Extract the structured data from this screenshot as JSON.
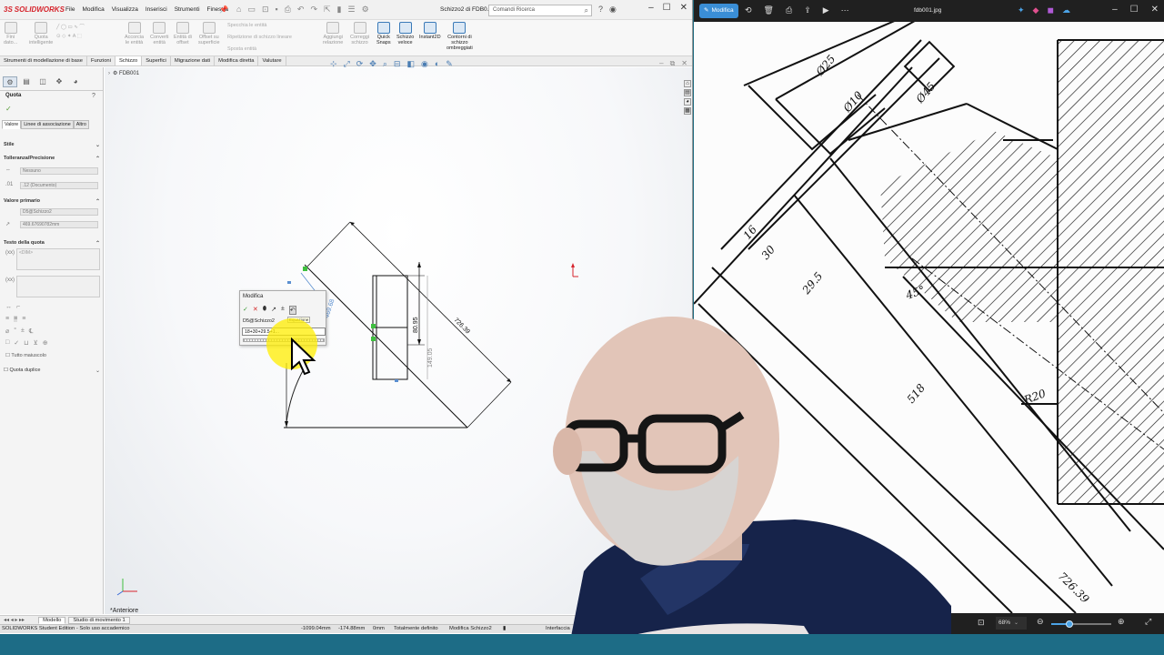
{
  "solidworks": {
    "logo_text": "SOLIDWORKS",
    "menu": [
      "File",
      "Modifica",
      "Visualizza",
      "Inserisci",
      "Strumenti",
      "Finestra"
    ],
    "doc_title": "Schizzo2 di FDB0...",
    "search_placeholder": "Comandi Ricerca",
    "ribbon": {
      "buttons": [
        {
          "label": "Fini\ndato...",
          "enabled": false
        },
        {
          "label": "Quota\nintelligente",
          "enabled": false
        },
        {
          "label": "Accorcia\nle entità",
          "enabled": false
        },
        {
          "label": "Converti\nentità",
          "enabled": false
        },
        {
          "label": "Entità di\noffset",
          "enabled": false
        },
        {
          "label": "Offset su\nsuperficie",
          "enabled": false
        },
        {
          "label": "Aggiungi\nrelazione",
          "enabled": false
        },
        {
          "label": "Correggi\nschizzo",
          "enabled": false
        },
        {
          "label": "Quick\nSnaps",
          "enabled": true
        },
        {
          "label": "Schizzo\nveloce",
          "enabled": true
        },
        {
          "label": "Instant2D",
          "enabled": true
        },
        {
          "label": "Contorni di\nschizzo\nombreggiati",
          "enabled": true
        }
      ],
      "small_items": [
        "Specchia le entità",
        "Ripetizione di schizzo lineare",
        "Sposta entità"
      ]
    },
    "command_tabs": [
      "Strumenti di modellazione di base",
      "Funzioni",
      "Schizzo",
      "Superfici",
      "Migrazione dati",
      "Modifica diretta",
      "Valutare"
    ],
    "active_command_tab": "Schizzo",
    "property_manager": {
      "title": "Quota",
      "subtabs": [
        "Valore",
        "Linee di associazione",
        "Altro"
      ],
      "sections": {
        "stile": "Stile",
        "tolleranza": "Tolleranza/Precisione",
        "tolleranza_value": "Nessuno",
        "precisione_value": ".12 (Documento)",
        "valore_primario": "Valore primario",
        "dim_name": "D5@Schizzo2",
        "dim_value": "469.67690782mm",
        "testo_quota": "Testo della quota",
        "dim_token": "<DIM>",
        "tutto_maiuscolo": "Tutto maiuscolo",
        "quota_duplice": "Quota duplice"
      }
    },
    "tree_root": "FDB001",
    "view_label": "*Anteriore",
    "dimensions": {
      "diag": "726.39",
      "vert": "80.95",
      "vert2": "149.05",
      "small": "469.68"
    },
    "modify_dialog": {
      "title": "Modifica",
      "dim_name": "D5@Schizzo2",
      "tooltip": "Equazione",
      "expression": "18+30+29.5+1..."
    },
    "bottom_tabs": [
      "Modello",
      "Studio di movimento 1"
    ],
    "active_bottom_tab": "Modello",
    "status": {
      "edition": "SOLIDWORKS Student Edition - Solo uso accademico",
      "x": "-1099.04mm",
      "y": "-174.88mm",
      "z": "0mm",
      "state": "Totalmente definito",
      "editing": "Modifica Schizzo2",
      "interface": "Interfaccia"
    }
  },
  "photo_viewer": {
    "edit_button": "Modifica",
    "file_name": "fdb001.jpg",
    "zoom_level": "68%",
    "zoom_fraction": 0.3
  },
  "drawing_labels": [
    "Ø25",
    "Ø10",
    "Ø45",
    "16",
    "29.5",
    "45°",
    "518",
    "R20",
    "726.39",
    "30"
  ],
  "colors": {
    "sw_red": "#d6242c",
    "accent_blue": "#3a8ed6",
    "sketch_black": "#111111",
    "dim_blue": "#5b8fd0",
    "highlight_yellow": "#ffee00",
    "viewer_dark": "#202020"
  }
}
